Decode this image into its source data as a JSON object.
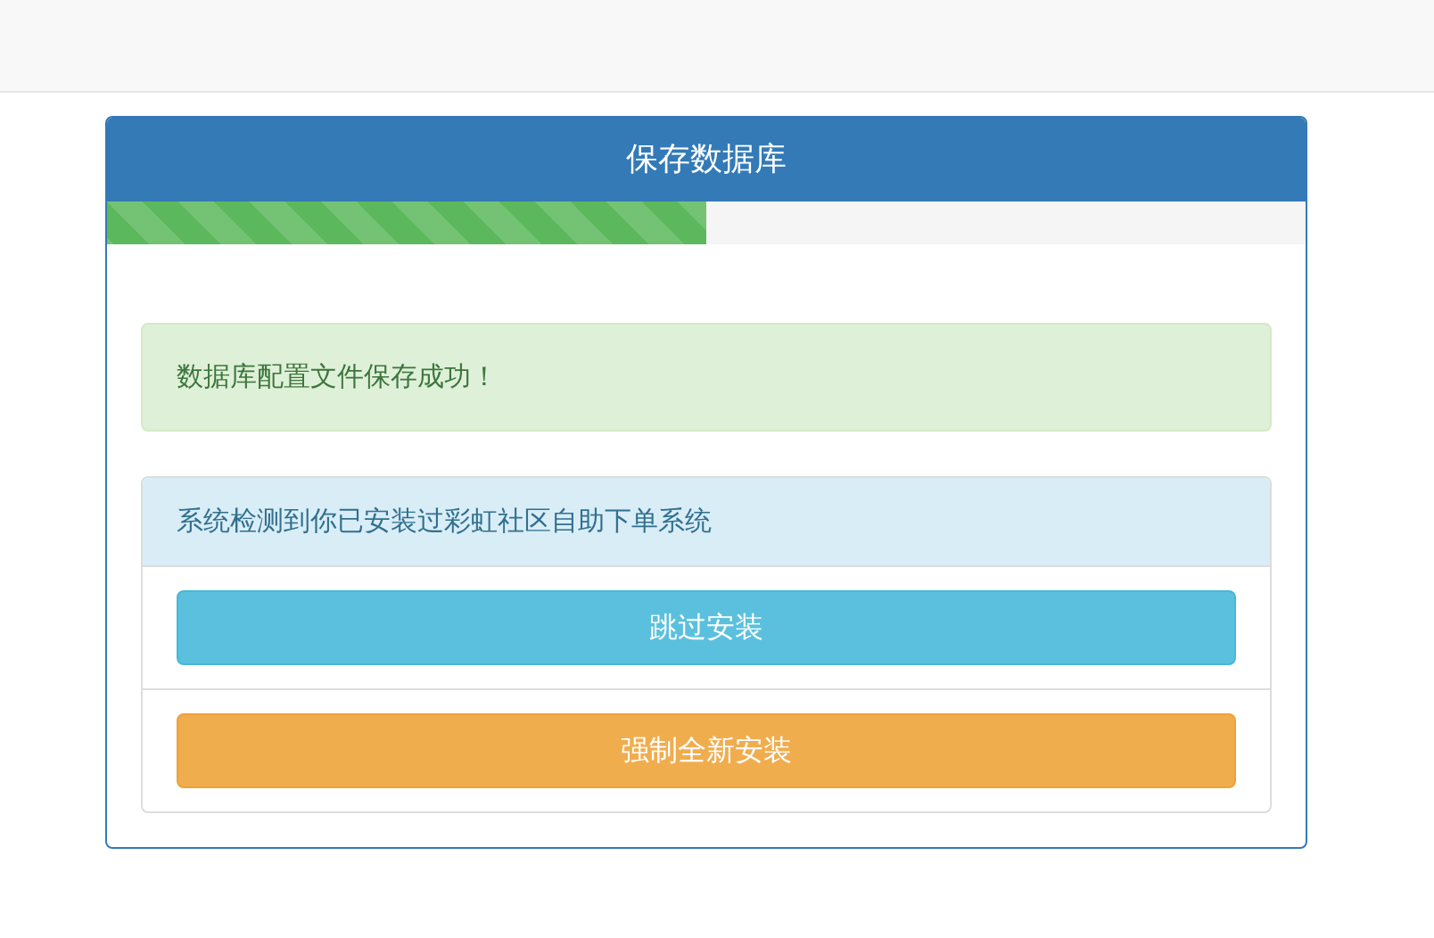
{
  "panel": {
    "title": "保存数据库",
    "progress": {
      "level": 0.5
    }
  },
  "alert": {
    "text": "数据库配置文件保存成功！"
  },
  "notice": {
    "heading": "系统检测到你已安装过彩虹社区自助下单系统",
    "buttons": [
      {
        "label": "跳过安装",
        "kind": "info"
      },
      {
        "label": "强制全新安装",
        "kind": "warning"
      }
    ]
  }
}
